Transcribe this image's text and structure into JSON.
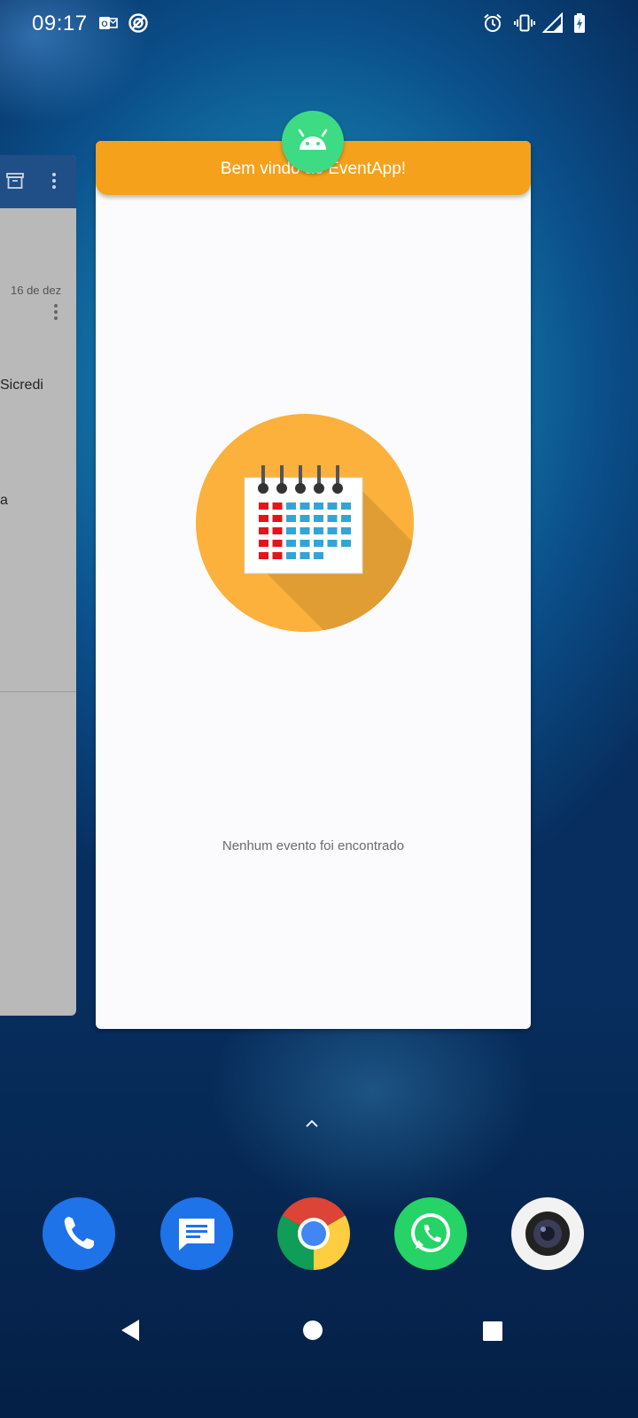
{
  "status_bar": {
    "time": "09:17",
    "left_icons": [
      "outlook-icon",
      "vpn-icon"
    ],
    "right_icons": [
      "alarm-icon",
      "vibrate-icon",
      "signal-icon",
      "battery-charging-icon"
    ]
  },
  "recents": {
    "left_card": {
      "date": "16 de dez",
      "snippet_1": "Sicredi",
      "snippet_2": "a"
    },
    "main_card": {
      "app_icon": "android-icon",
      "header_title": "Bem vindo ao EventApp!",
      "illustration": "calendar-icon",
      "empty_message": "Nenhum evento foi encontrado"
    }
  },
  "dock": {
    "apps": [
      "phone-icon",
      "messages-icon",
      "chrome-icon",
      "whatsapp-icon",
      "camera-icon"
    ]
  },
  "colors": {
    "app_bar": "#f6a11c",
    "android_green": "#3ddc84",
    "calendar_circle": "#fbb13c"
  }
}
